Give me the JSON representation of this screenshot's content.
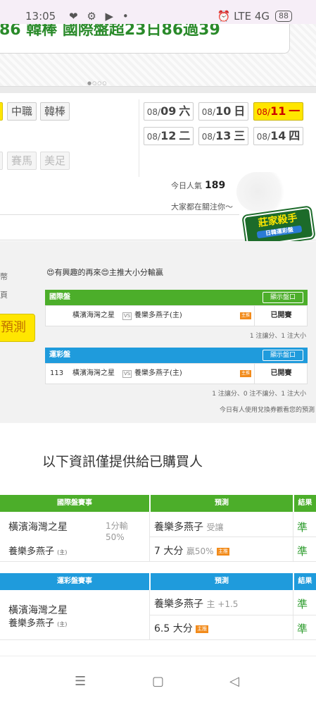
{
  "status_bar": {
    "time": "13:05",
    "notif_icons": "❤ ⚙ ▶ •",
    "right_icons": "⏰ LTE 4G",
    "battery": "88"
  },
  "banner": {
    "headline_partial": "86 韓棒 國際盤超23日86過39"
  },
  "leagues": {
    "items": [
      "中職",
      "韓棒"
    ],
    "muted": [
      "賽馬",
      "美足"
    ]
  },
  "dates": [
    {
      "md": "08/",
      "d": "09",
      "w": "六",
      "active": false
    },
    {
      "md": "08/",
      "d": "10",
      "w": "日",
      "active": false
    },
    {
      "md": "08/",
      "d": "11",
      "w": "一",
      "active": true
    },
    {
      "md": "08/",
      "d": "12",
      "w": "二",
      "active": false
    },
    {
      "md": "08/",
      "d": "13",
      "w": "三",
      "active": false
    },
    {
      "md": "08/",
      "d": "14",
      "w": "四",
      "active": false
    }
  ],
  "popularity": {
    "label": "今日人氣",
    "value": "189",
    "attention": "大家都在關注你～"
  },
  "logo": {
    "title": "莊家殺手",
    "subtitle": "日韓運彩盤",
    "ribbon": "實戰"
  },
  "left_labels": {
    "l1": "幣",
    "l2": "頁"
  },
  "predict_btn": "預測",
  "tip": "😍有興趣的再來😍主推大小分輸贏",
  "intl_table": {
    "header": "國際盤",
    "show_btn": "顯示盤口",
    "row": {
      "num": "",
      "team1": "橫濱海灣之星",
      "vs": "VS",
      "team2": "養樂多燕子(主)",
      "tag": "主推",
      "status": "已開賽"
    },
    "note": "1 注讓分、1 注大小"
  },
  "lottery_table": {
    "header": "運彩盤",
    "show_btn": "顯示盤口",
    "row": {
      "num": "113",
      "team1": "橫濱海灣之星",
      "vs": "VS",
      "team2": "養樂多燕子(主)",
      "tag": "主推",
      "status": "已開賽"
    },
    "note": "1 注讓分、0 注不讓分、1 注大小",
    "note2": "今日有人使用兌換券觀看您的預測"
  },
  "purchase_notice": "以下資訊僅提供給已購買人",
  "result_intl": {
    "h_game": "國際盤賽事",
    "h_pred": "預測",
    "h_res": "結果",
    "team1": "橫濱海灣之星",
    "team2": "養樂多燕子",
    "host": "(主)",
    "odds": "1分輸",
    "odds2": "50%",
    "pred1_team": "養樂多燕子",
    "pred1_note": "受讓",
    "res1": "準",
    "pred2": "7 大分",
    "pred2_note": "贏50%",
    "tag": "主推",
    "res2": "準"
  },
  "result_lottery": {
    "h_game": "運彩盤賽事",
    "h_pred": "預測",
    "h_res": "結果",
    "team1": "橫濱海灣之星",
    "team2": "養樂多燕子",
    "host": "(主)",
    "pred1_team": "養樂多燕子",
    "pred1_note": "主 +1.5",
    "res1": "準",
    "pred2": "6.5 大分",
    "tag": "主推",
    "res2": "準"
  },
  "nav": {
    "menu": "☰",
    "home": "▢",
    "back": "◁"
  }
}
